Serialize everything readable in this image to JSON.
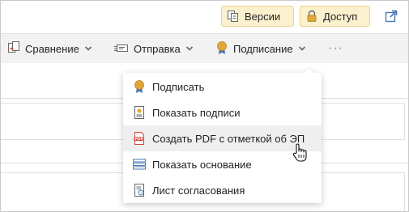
{
  "header": {
    "versions_label": "Версии",
    "access_label": "Доступ"
  },
  "toolbar": {
    "compare_label": "Сравнение",
    "send_label": "Отправка",
    "sign_label": "Подписание",
    "more_label": "···"
  },
  "sign_menu": {
    "items": [
      {
        "label": "Подписать",
        "icon": "seal-icon"
      },
      {
        "label": "Показать подписи",
        "icon": "signature-doc-icon"
      },
      {
        "label": "Создать PDF с отметкой об ЭП",
        "icon": "pdf-icon",
        "hovered": true
      },
      {
        "label": "Показать основание",
        "icon": "stack-icon"
      },
      {
        "label": "Лист согласования",
        "icon": "approval-sheet-icon"
      }
    ]
  },
  "colors": {
    "button_bg": "#fbf1cf",
    "button_border": "#e8d48f",
    "toolbar_bg": "#f2f2f2",
    "seal_gold": "#e0a83a",
    "pdf_red": "#d9423a",
    "stack_blue": "#4a78b5",
    "menu_hover": "#efefef"
  }
}
